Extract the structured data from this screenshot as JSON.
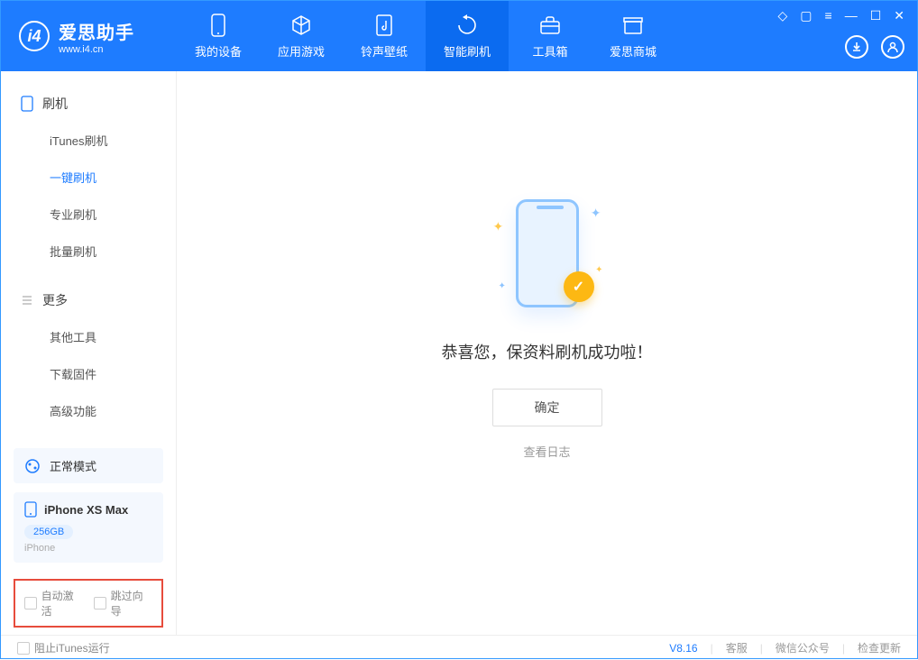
{
  "app": {
    "title": "爱思助手",
    "subtitle": "www.i4.cn"
  },
  "tabs": [
    {
      "label": "我的设备"
    },
    {
      "label": "应用游戏"
    },
    {
      "label": "铃声壁纸"
    },
    {
      "label": "智能刷机"
    },
    {
      "label": "工具箱"
    },
    {
      "label": "爱思商城"
    }
  ],
  "sidebar": {
    "group1_title": "刷机",
    "items1": [
      {
        "label": "iTunes刷机"
      },
      {
        "label": "一键刷机"
      },
      {
        "label": "专业刷机"
      },
      {
        "label": "批量刷机"
      }
    ],
    "group2_title": "更多",
    "items2": [
      {
        "label": "其他工具"
      },
      {
        "label": "下载固件"
      },
      {
        "label": "高级功能"
      }
    ]
  },
  "device": {
    "mode": "正常模式",
    "name": "iPhone XS Max",
    "storage": "256GB",
    "type": "iPhone"
  },
  "options": {
    "auto_activate": "自动激活",
    "skip_guide": "跳过向导"
  },
  "main": {
    "success": "恭喜您，保资料刷机成功啦！",
    "ok": "确定",
    "view_log": "查看日志"
  },
  "footer": {
    "block_itunes": "阻止iTunes运行",
    "version": "V8.16",
    "support": "客服",
    "wechat": "微信公众号",
    "update": "检查更新"
  }
}
